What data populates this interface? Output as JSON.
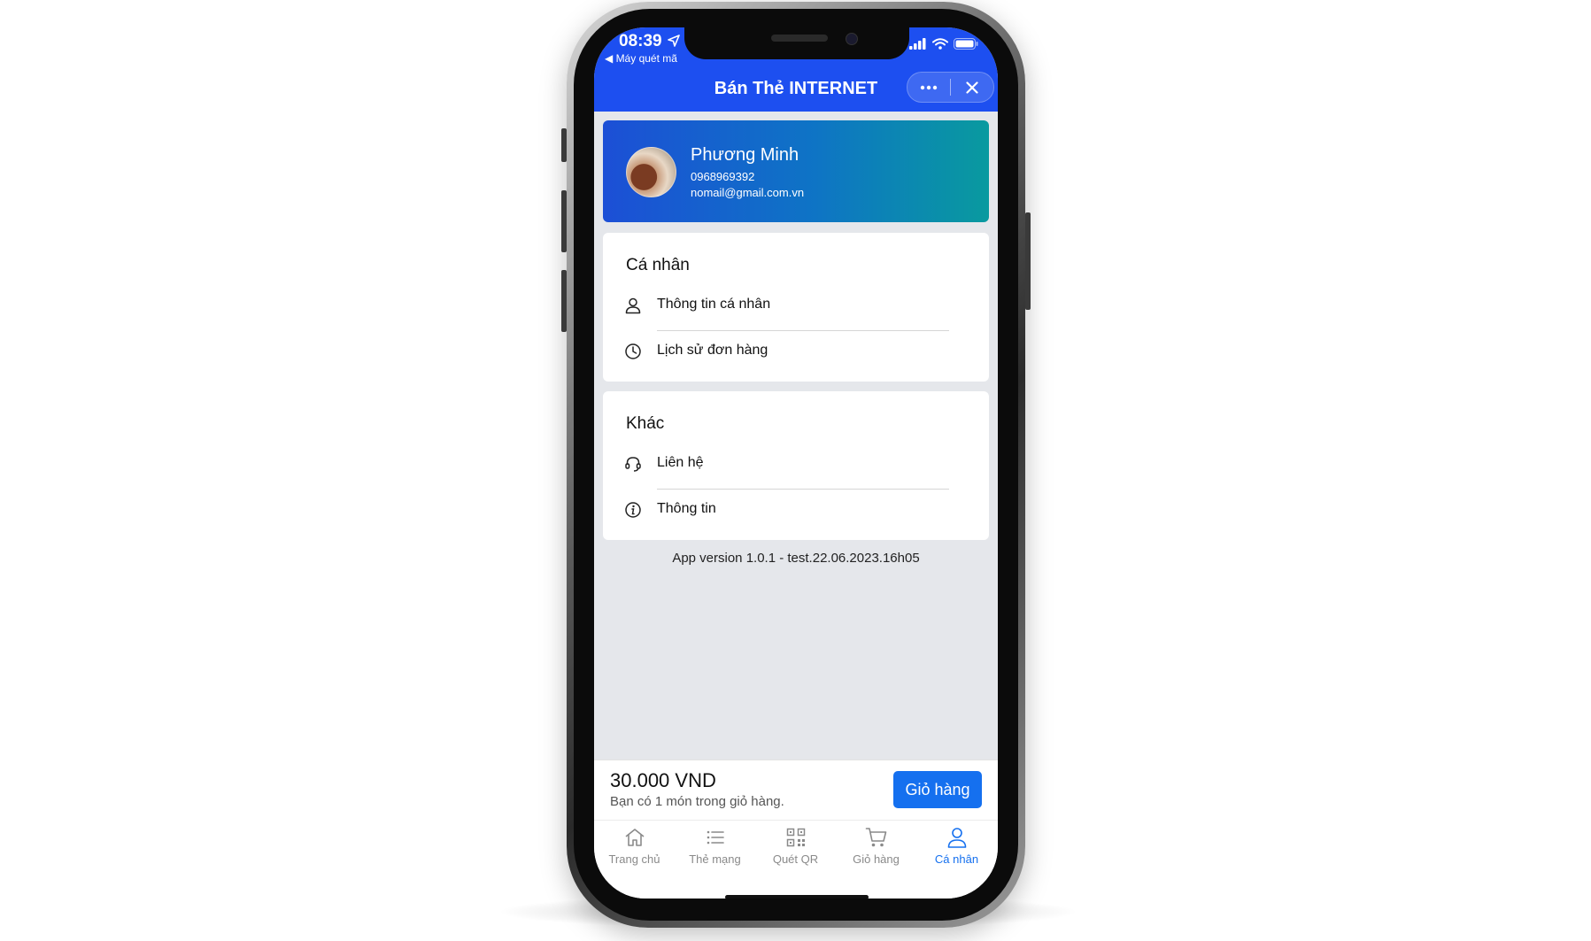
{
  "status_bar": {
    "time": "08:39",
    "back_app": "◀ Máy quét mã"
  },
  "app_header": {
    "title": "Bán Thẻ INTERNET",
    "more_icon": "more-dots-icon",
    "close_icon": "close-icon"
  },
  "profile": {
    "name": "Phương Minh",
    "phone": "0968969392",
    "email": "nomail@gmail.com.vn"
  },
  "personal_section": {
    "title": "Cá nhân",
    "items": [
      {
        "label": "Thông tin cá nhân",
        "icon": "user-icon"
      },
      {
        "label": "Lịch sử đơn hàng",
        "icon": "clock-icon"
      }
    ]
  },
  "other_section": {
    "title": "Khác",
    "items": [
      {
        "label": "Liên hệ",
        "icon": "headset-icon"
      },
      {
        "label": "Thông tin",
        "icon": "info-icon"
      }
    ]
  },
  "version_text": "App version 1.0.1 - test.22.06.2023.16h05",
  "cart_bar": {
    "total": "30.000 VND",
    "note": "Bạn có 1 món trong giỏ hàng.",
    "button": "Giỏ hàng"
  },
  "tabs": [
    {
      "label": "Trang chủ",
      "icon": "home-icon",
      "active": false
    },
    {
      "label": "Thẻ mạng",
      "icon": "list-icon",
      "active": false
    },
    {
      "label": "Quét QR",
      "icon": "qr-code-icon",
      "active": false
    },
    {
      "label": "Giỏ hàng",
      "icon": "cart-icon",
      "active": false
    },
    {
      "label": "Cá nhân",
      "icon": "user-icon",
      "active": true
    }
  ],
  "colors": {
    "primary": "#1d4ff0",
    "button": "#1570ef",
    "active_tab": "#1570ef",
    "background": "#e5e7eb"
  }
}
